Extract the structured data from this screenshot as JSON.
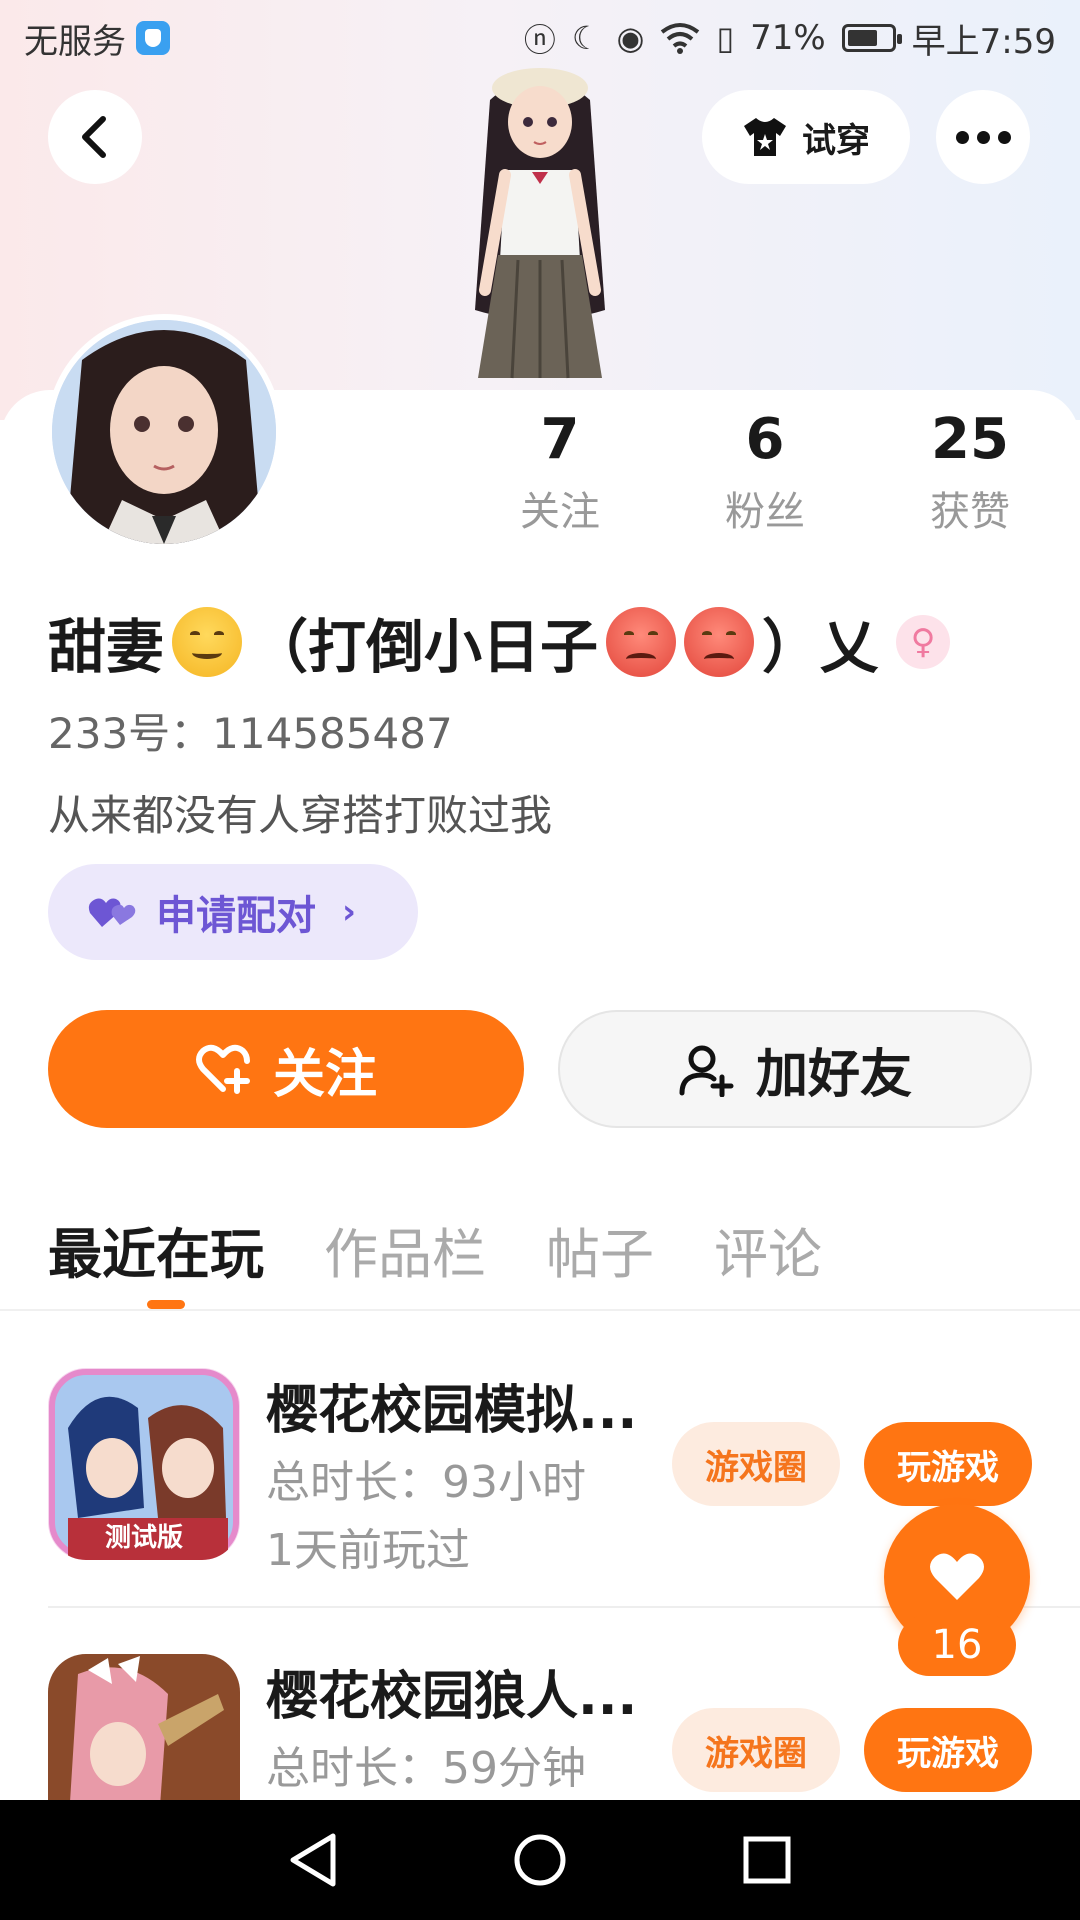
{
  "status_bar": {
    "carrier": "无服务",
    "battery": "71%",
    "battery_level": 0.71,
    "time": "早上7:59"
  },
  "header": {
    "try_on_label": "试穿"
  },
  "profile": {
    "stats": [
      {
        "value": "7",
        "label": "关注"
      },
      {
        "value": "6",
        "label": "粉丝"
      },
      {
        "value": "25",
        "label": "获赞"
      }
    ],
    "name_prefix": "甜妻",
    "name_middle": "（打倒小日子",
    "name_suffix": "）乂",
    "uid": "233号：114585487",
    "bio": "从来都没有人穿搭打败过我",
    "pair_label": "申请配对"
  },
  "actions": {
    "follow_label": "关注",
    "add_friend_label": "加好友"
  },
  "tabs": [
    "最近在玩",
    "作品栏",
    "帖子",
    "评论"
  ],
  "games": [
    {
      "title": "樱花校园模拟...",
      "duration": "总时长：93小时",
      "last_played": "1天前玩过",
      "circle_label": "游戏圈",
      "play_label": "玩游戏",
      "icon_badge": "测试版"
    },
    {
      "title": "樱花校园狼人...",
      "duration": "总时长：59分钟",
      "last_played": "",
      "circle_label": "游戏圈",
      "play_label": "玩游戏"
    }
  ],
  "like": {
    "count": "16"
  },
  "colors": {
    "accent": "#ff7512",
    "pair_text": "#6d56d4",
    "pair_bg": "#ece8fb"
  }
}
